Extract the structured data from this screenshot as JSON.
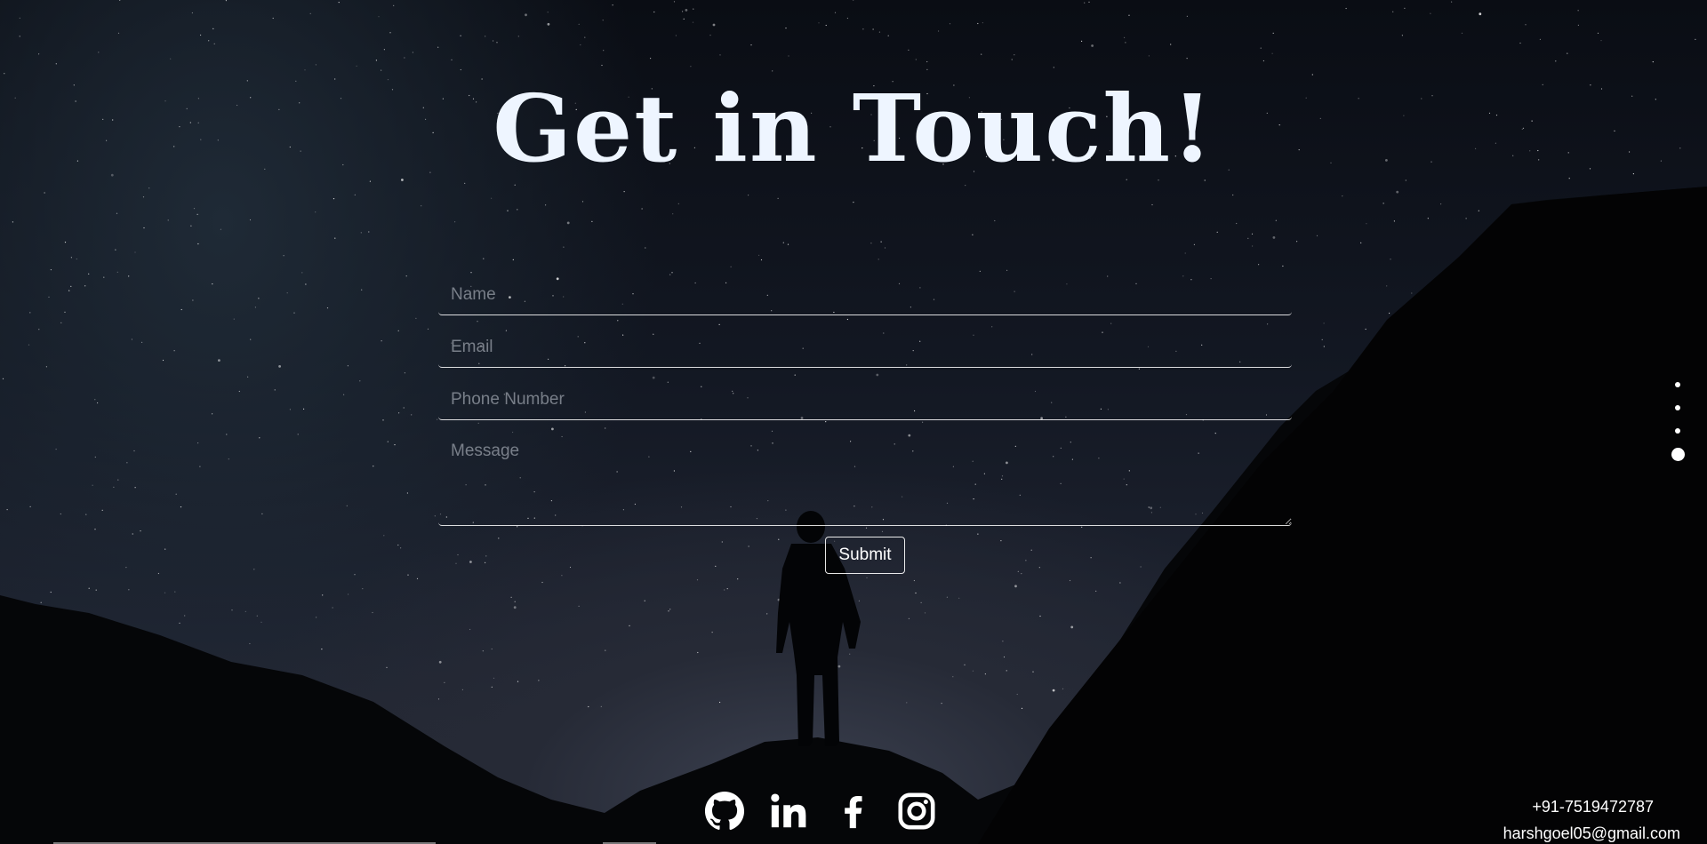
{
  "page": {
    "title": "Get in Touch!"
  },
  "form": {
    "name_placeholder": "Name",
    "email_placeholder": "Email",
    "phone_placeholder": "Phone Number",
    "message_placeholder": "Message",
    "submit_label": "Submit"
  },
  "section_nav": {
    "count": 4,
    "active_index": 3
  },
  "socials": [
    {
      "icon": "github-icon"
    },
    {
      "icon": "linkedin-icon"
    },
    {
      "icon": "facebook-icon"
    },
    {
      "icon": "instagram-icon"
    }
  ],
  "contact": {
    "phone": "+91-7519472787",
    "email": "harshgoel05@gmail.com"
  },
  "colors": {
    "title": "#eef5ff",
    "text": "#ffffff",
    "sky_top": "#0a0d14",
    "sky_glow": "#3c4150"
  }
}
